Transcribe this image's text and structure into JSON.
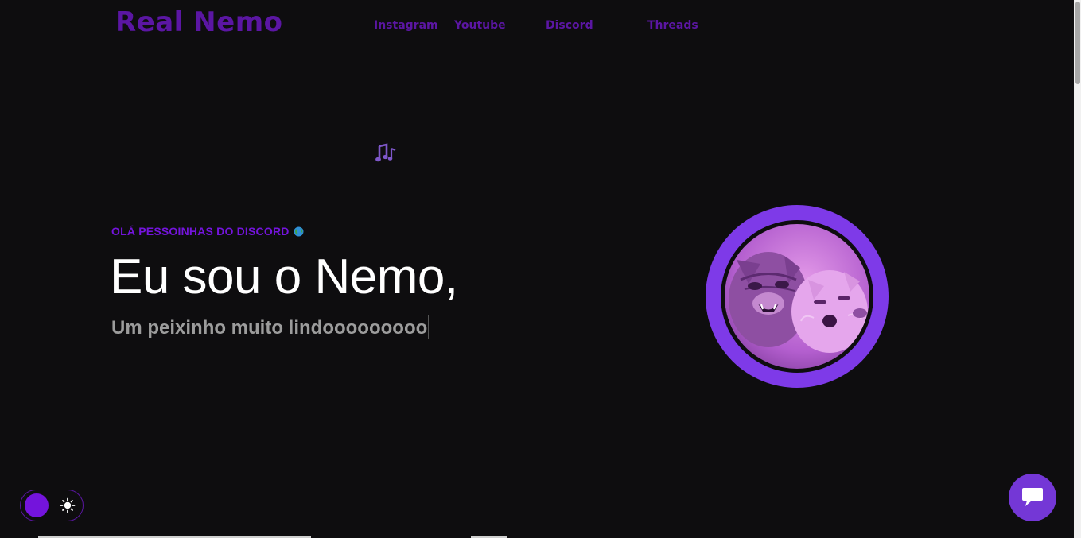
{
  "header": {
    "logo": "Real Nemo",
    "nav": [
      {
        "label": "Instagram"
      },
      {
        "label": "Youtube"
      },
      {
        "label": "Discord"
      },
      {
        "label": "Threads"
      }
    ]
  },
  "hero": {
    "greeting": "OLÁ PESSOINHAS DO DISCORD",
    "greeting_emoji": "globe-icon",
    "headline": "Eu sou o Nemo,",
    "subline": "Um peixinho muito lindooooooooo",
    "music_icon": "music-notes-icon",
    "avatar": "avatar-image"
  },
  "controls": {
    "theme_toggle_icon": "sun-icon",
    "chat_icon": "chat-bubble-icon"
  },
  "colors": {
    "background": "#0e0d0f",
    "accent": "#7414dc",
    "logo": "#5b16a3",
    "ring": "#7e3ae8",
    "chat": "#7437d6"
  }
}
